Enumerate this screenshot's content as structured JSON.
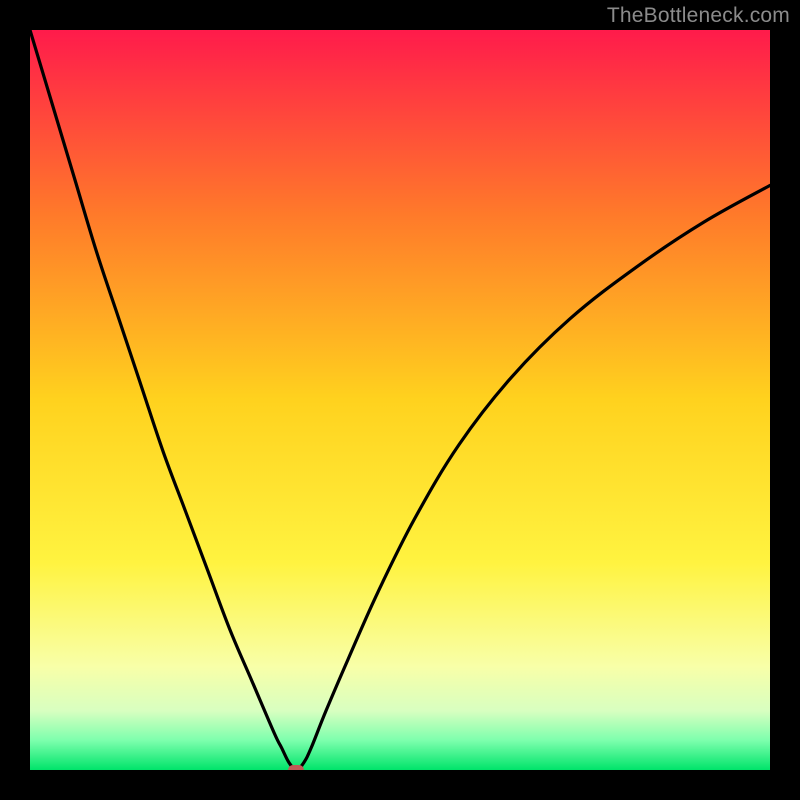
{
  "watermark": "TheBottleneck.com",
  "colors": {
    "frame": "#000000",
    "curve": "#000000",
    "dot": "#c05a56",
    "watermark": "#8b8b8b"
  },
  "chart_data": {
    "type": "line",
    "title": "",
    "xlabel": "",
    "ylabel": "",
    "xlim": [
      0,
      100
    ],
    "ylim": [
      0,
      100
    ],
    "gradient_stops": [
      {
        "offset": 0,
        "color": "#ff1b4b"
      },
      {
        "offset": 25,
        "color": "#ff7a2a"
      },
      {
        "offset": 50,
        "color": "#ffd21e"
      },
      {
        "offset": 72,
        "color": "#fff340"
      },
      {
        "offset": 86,
        "color": "#f8ffa8"
      },
      {
        "offset": 92,
        "color": "#d8ffc0"
      },
      {
        "offset": 96,
        "color": "#7dffad"
      },
      {
        "offset": 100,
        "color": "#00e46a"
      }
    ],
    "series": [
      {
        "name": "bottleneck-curve",
        "x": [
          0,
          3,
          6,
          9,
          12,
          15,
          18,
          21,
          24,
          27,
          30,
          33,
          34,
          35,
          36,
          37,
          38,
          40,
          43,
          47,
          52,
          58,
          65,
          73,
          82,
          91,
          100
        ],
        "y": [
          100,
          90,
          80,
          70,
          61,
          52,
          43,
          35,
          27,
          19,
          12,
          5,
          3,
          1,
          0,
          1,
          3,
          8,
          15,
          24,
          34,
          44,
          53,
          61,
          68,
          74,
          79
        ]
      }
    ],
    "min_point": {
      "x": 36,
      "y": 0
    }
  }
}
